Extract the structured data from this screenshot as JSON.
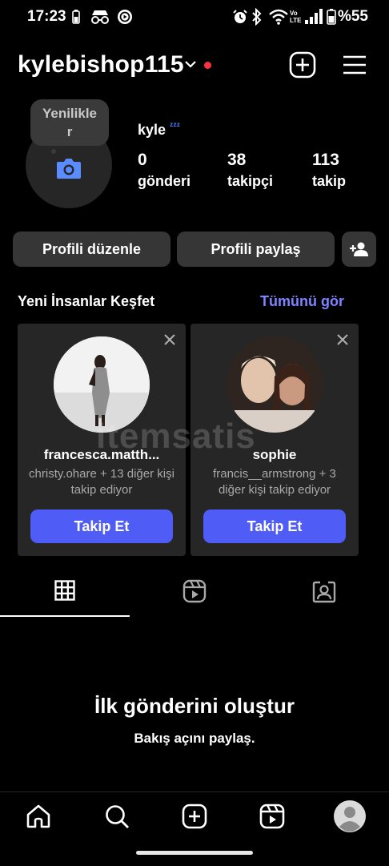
{
  "status_bar": {
    "time": "17:23",
    "battery": "%55",
    "volte": "Vo LTE"
  },
  "header": {
    "username": "kylebishop115"
  },
  "profile": {
    "bubble_text_line1": "Yenilikle",
    "bubble_text_line2": "r",
    "display_name": "kyle",
    "sleep_emoji": "ᶻᶻᶻ",
    "stats": [
      {
        "value": "0",
        "label": "gönderi"
      },
      {
        "value": "38",
        "label": "takipçi"
      },
      {
        "value": "113",
        "label": "takip"
      }
    ]
  },
  "actions": {
    "edit_profile": "Profili düzenle",
    "share_profile": "Profili paylaş"
  },
  "discover": {
    "title": "Yeni İnsanlar Keşfet",
    "see_all": "Tümünü gör",
    "cards": [
      {
        "name": "francesca.matth...",
        "sub": "christy.ohare + 13 diğer kişi takip ediyor",
        "follow": "Takip Et"
      },
      {
        "name": "sophie",
        "sub": "francis__armstrong + 3 diğer kişi takip ediyor",
        "follow": "Takip Et"
      }
    ]
  },
  "empty_state": {
    "title": "İlk gönderini oluştur",
    "subtitle": "Bakış açını paylaş."
  },
  "watermark": "itemsatis",
  "colors": {
    "accent": "#4f5cf5",
    "link": "#7f83ff",
    "notification_dot": "#ff3040",
    "card_bg": "#262626",
    "button_bg": "#363636"
  }
}
